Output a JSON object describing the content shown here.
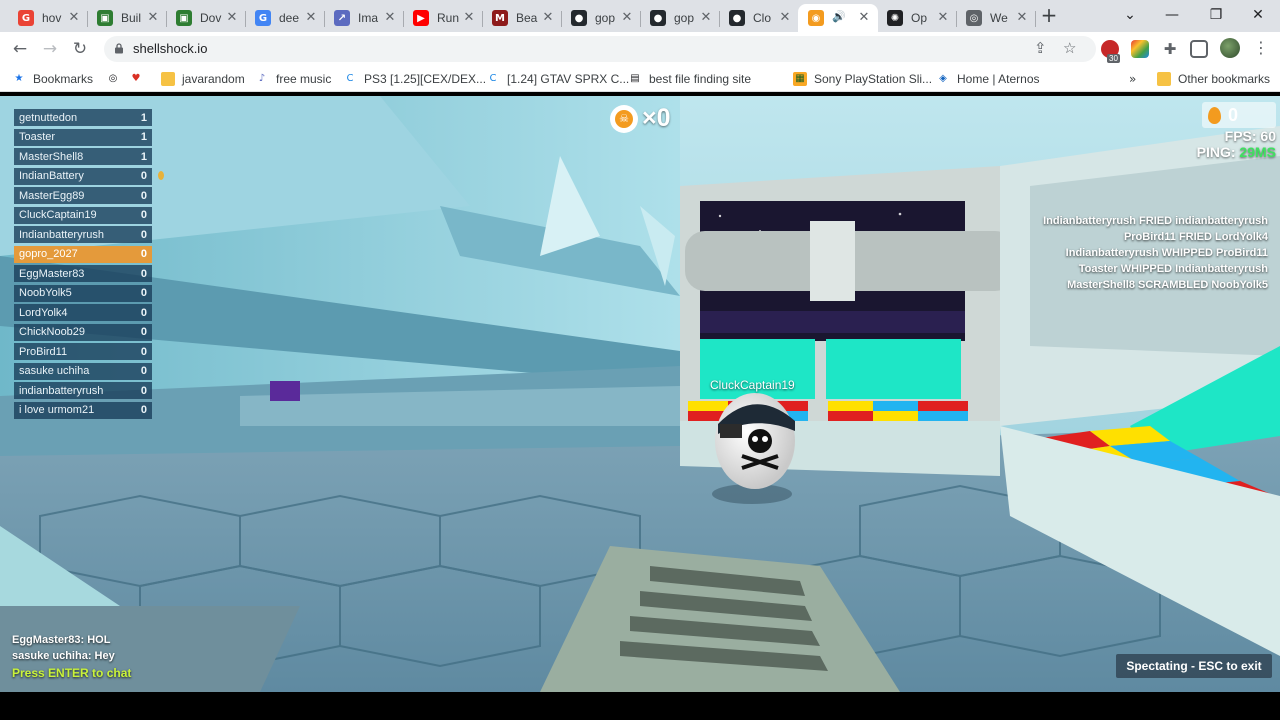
{
  "browser": {
    "tabs": [
      {
        "title": "hov",
        "icon": "google-icon",
        "color": "#ea4335"
      },
      {
        "title": "Buil",
        "icon": "minecraft-icon",
        "color": "#2e7d32"
      },
      {
        "title": "Dov",
        "icon": "minecraft-icon",
        "color": "#2e7d32"
      },
      {
        "title": "dee",
        "icon": "google-icon",
        "color": "#4285f4"
      },
      {
        "title": "Ima",
        "icon": "chart-icon",
        "color": "#5c6bc0"
      },
      {
        "title": "Run",
        "icon": "youtube-icon",
        "color": "#ff0000"
      },
      {
        "title": "Bea",
        "icon": "m-icon",
        "color": "#8e1b1b"
      },
      {
        "title": "gop",
        "icon": "github-icon",
        "color": "#24292e"
      },
      {
        "title": "gop",
        "icon": "github-icon",
        "color": "#24292e"
      },
      {
        "title": "Clo",
        "icon": "github-icon",
        "color": "#24292e"
      },
      {
        "title": "",
        "icon": "shellshock-icon",
        "color": "#f39b1f",
        "active": true
      },
      {
        "title": "Op",
        "icon": "openai-icon",
        "color": "#202124"
      },
      {
        "title": "We",
        "icon": "globe-icon",
        "color": "#5f6368"
      }
    ],
    "url": "shellshock.io",
    "extension_badge": "30",
    "bookmarks": [
      {
        "label": "Bookmarks",
        "icon": "star-icon"
      },
      {
        "label": "",
        "icon": "globe-icon"
      },
      {
        "label": "",
        "icon": "heart-icon"
      },
      {
        "label": "javarandom",
        "icon": "folder-icon"
      },
      {
        "label": "free music",
        "icon": "music-icon"
      },
      {
        "label": "PS3 [1.25][CEX/DEX...",
        "icon": "c-icon"
      },
      {
        "label": "[1.24] GTAV SPRX C...",
        "icon": "c-icon"
      },
      {
        "label": "best file finding site",
        "icon": "file-icon"
      },
      {
        "label": "Sony PlayStation Sli...",
        "icon": "playstation-icon"
      },
      {
        "label": "Home | Aternos",
        "icon": "aternos-icon"
      },
      {
        "label": "Other bookmarks",
        "icon": "folder-icon"
      }
    ]
  },
  "game": {
    "scoreboard": [
      {
        "name": "getnuttedon",
        "score": "1"
      },
      {
        "name": "Toaster",
        "score": "1"
      },
      {
        "name": "MasterShell8",
        "score": "1"
      },
      {
        "name": "IndianBattery",
        "score": "0"
      },
      {
        "name": "MasterEgg89",
        "score": "0"
      },
      {
        "name": "CluckCaptain19",
        "score": "0"
      },
      {
        "name": "Indianbatteryrush",
        "score": "0"
      },
      {
        "name": "gopro_2027",
        "score": "0",
        "me": true
      },
      {
        "name": "EggMaster83",
        "score": "0"
      },
      {
        "name": "NoobYolk5",
        "score": "0"
      },
      {
        "name": "LordYolk4",
        "score": "0"
      },
      {
        "name": "ChickNoob29",
        "score": "0"
      },
      {
        "name": "ProBird11",
        "score": "0"
      },
      {
        "name": "sasuke uchiha",
        "score": "0"
      },
      {
        "name": "indianbatteryrush",
        "score": "0"
      },
      {
        "name": "i love urmom21",
        "score": "0"
      }
    ],
    "kills": "×0",
    "eggs": "0",
    "fps_label": "FPS:",
    "fps": "60",
    "ping_label": "PING:",
    "ping": "29MS",
    "killfeed": [
      "Indianbatteryrush FRIED indianbatteryrush",
      "ProBird11 FRIED LordYolk4",
      "Indianbatteryrush WHIPPED ProBird11",
      "Toaster WHIPPED Indianbatteryrush",
      "MasterShell8 SCRAMBLED NoobYolk5"
    ],
    "player_label": "CluckCaptain19",
    "chat": [
      "EggMaster83: HOL",
      "sasuke uchiha: Hey"
    ],
    "chat_prompt": "Press ENTER to chat",
    "spectating": "Spectating - ESC to exit",
    "colors": {
      "accent": "#e49a3b",
      "ping_good": "#3fe060",
      "prompt": "#c9f23a"
    }
  }
}
